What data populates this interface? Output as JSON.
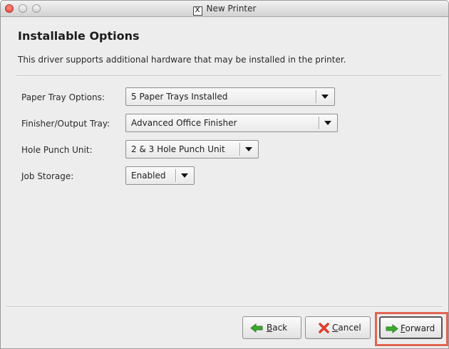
{
  "window": {
    "title": "New Printer",
    "title_icon_glyph": "X",
    "title_icon_name": "x11-icon"
  },
  "page": {
    "heading": "Installable Options",
    "description": "This driver supports additional hardware that may be installed in the printer."
  },
  "options": [
    {
      "label": "Paper Tray Options:",
      "value": "5 Paper Trays Installed"
    },
    {
      "label": "Finisher/Output Tray:",
      "value": "Advanced Office Finisher"
    },
    {
      "label": "Hole Punch Unit:",
      "value": "2 & 3 Hole Punch Unit"
    },
    {
      "label": "Job Storage:",
      "value": "Enabled"
    }
  ],
  "buttons": {
    "back": {
      "mnemonic": "B",
      "rest": "ack",
      "icon": "back-arrow-icon"
    },
    "cancel": {
      "mnemonic": "C",
      "rest": "ancel",
      "icon": "cancel-x-icon"
    },
    "forward": {
      "mnemonic": "F",
      "rest": "orward",
      "icon": "forward-arrow-icon"
    }
  },
  "colors": {
    "highlight": "#e06552",
    "arrow_green": "#3bab2e",
    "cancel_red": "#e23a2c",
    "close_red": "#e2453a"
  }
}
